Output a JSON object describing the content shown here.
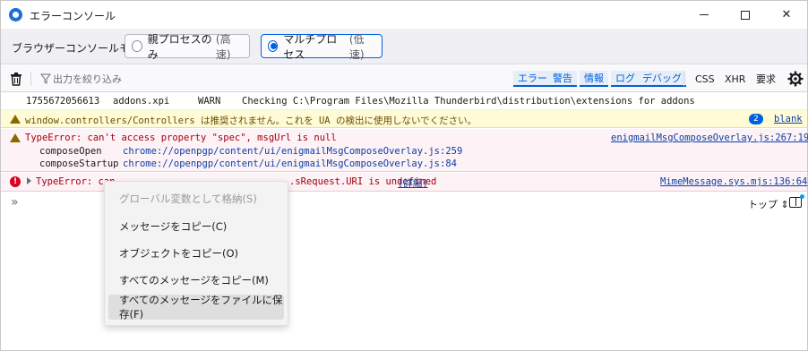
{
  "window": {
    "title": "エラーコンソール",
    "controls": {
      "minimize": "—",
      "maximize": "□",
      "close": "✕"
    }
  },
  "modebar": {
    "label": "ブラウザーコンソールモード",
    "options": [
      {
        "label": "親プロセスのみ",
        "sub": "(高速)",
        "selected": false
      },
      {
        "label": "マルチプロセス",
        "sub": "(低速)",
        "selected": true
      }
    ]
  },
  "toolbar": {
    "filter_placeholder": "出力を絞り込み",
    "levels": [
      "エラー",
      "警告",
      "情報",
      "ログ",
      "デバッグ"
    ],
    "categories": [
      "CSS",
      "XHR",
      "要求"
    ]
  },
  "messages": {
    "log": {
      "timestamp": "1755672056613",
      "source": "addons.xpi",
      "level": "WARN",
      "text": "Checking C:\\Program Files\\Mozilla Thunderbird\\distribution\\extensions for addons"
    },
    "warning": {
      "text": "window.controllers/Controllers は推奨されません。これを UA の検出に使用しないでください。",
      "count": "2",
      "location": "blank"
    },
    "error1": {
      "text": "TypeError: can't access property \"spec\", msgUrl is null",
      "location": "enigmailMsgComposeOverlay.js:267:19",
      "stack": [
        {
          "fn": "composeOpen",
          "loc": "chrome://openpgp/content/ui/enigmailMsgComposeOverlay.js:259"
        },
        {
          "fn": "composeStartup",
          "loc": "chrome://openpgp/content/ui/enigmailMsgComposeOverlay.js:84"
        }
      ]
    },
    "error2": {
      "text_start": "TypeError: can",
      "text_end": ".sRequest.URI is undefined",
      "details": "[詳細]",
      "location": "MimeMessage.sys.mjs:136:64"
    }
  },
  "input_row": {
    "prompt": "»",
    "context_selector": "トップ ⇕"
  },
  "context_menu": {
    "items": [
      {
        "label": "グローバル変数として格納(S)",
        "disabled": true
      },
      {
        "label": "メッセージをコピー(C)",
        "disabled": false
      },
      {
        "label": "オブジェクトをコピー(O)",
        "disabled": false
      },
      {
        "label": "すべてのメッセージをコピー(M)",
        "disabled": false
      },
      {
        "label": "すべてのメッセージをファイルに保存(F)",
        "disabled": false
      }
    ]
  }
}
